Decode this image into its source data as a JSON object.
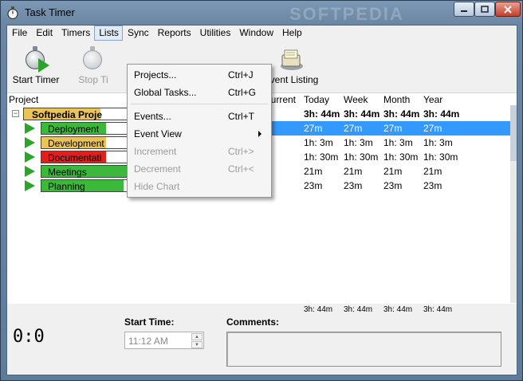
{
  "window": {
    "title": "Task Timer",
    "watermark": "SOFTPEDIA"
  },
  "menubar": [
    "File",
    "Edit",
    "Timers",
    "Lists",
    "Sync",
    "Reports",
    "Utilities",
    "Window",
    "Help"
  ],
  "toolbar": {
    "start": "Start Timer",
    "stop": "Stop Ti",
    "event": "Event Listing"
  },
  "columns": {
    "project": "Project",
    "current": "Current",
    "today": "Today",
    "week": "Week",
    "month": "Month",
    "year": "Year"
  },
  "project": {
    "name": "Softpedia Proje",
    "today": "3h: 44m",
    "week": "3h: 44m",
    "month": "3h: 44m",
    "year": "3h: 44m",
    "color": "#e8c45a"
  },
  "tasks": [
    {
      "name": "Deployment",
      "today": "27m",
      "week": "27m",
      "month": "27m",
      "year": "27m",
      "color": "#3cb83c",
      "fill": 0.3
    },
    {
      "name": "Development",
      "today": "1h: 3m",
      "week": "1h: 3m",
      "month": "1h: 3m",
      "year": "1h: 3m",
      "color": "#e8c45a",
      "fill": 0.3
    },
    {
      "name": "Documentati",
      "today": "1h: 30m",
      "week": "1h: 30m",
      "month": "1h: 30m",
      "year": "1h: 30m",
      "color": "#e02020",
      "fill": 0.3
    },
    {
      "name": "Meetings",
      "today": "21m",
      "week": "21m",
      "month": "21m",
      "year": "21m",
      "color": "#3cb83c",
      "fill": 0.46
    },
    {
      "name": "Planning",
      "today": "23m",
      "week": "23m",
      "month": "23m",
      "year": "23m",
      "color": "#3cb83c",
      "fill": 0.38
    }
  ],
  "totals": {
    "today": "3h: 44m",
    "week": "3h: 44m",
    "month": "3h: 44m",
    "year": "3h: 44m"
  },
  "bottom": {
    "timer": "0:0",
    "start_label": "Start Time:",
    "start_value": "11:12 AM",
    "comments_label": "Comments:"
  },
  "lists_menu": [
    {
      "label": "Projects...",
      "shortcut": "Ctrl+J",
      "disabled": false
    },
    {
      "label": "Global Tasks...",
      "shortcut": "Ctrl+G",
      "disabled": false
    },
    {
      "label": "Events...",
      "shortcut": "Ctrl+T",
      "disabled": false
    },
    {
      "label": "Event View",
      "shortcut": "",
      "disabled": false,
      "submenu": true
    },
    {
      "label": "Increment",
      "shortcut": "Ctrl+>",
      "disabled": true
    },
    {
      "label": "Decrement",
      "shortcut": "Ctrl+<",
      "disabled": true
    },
    {
      "label": "Hide Chart",
      "shortcut": "",
      "disabled": true
    }
  ]
}
